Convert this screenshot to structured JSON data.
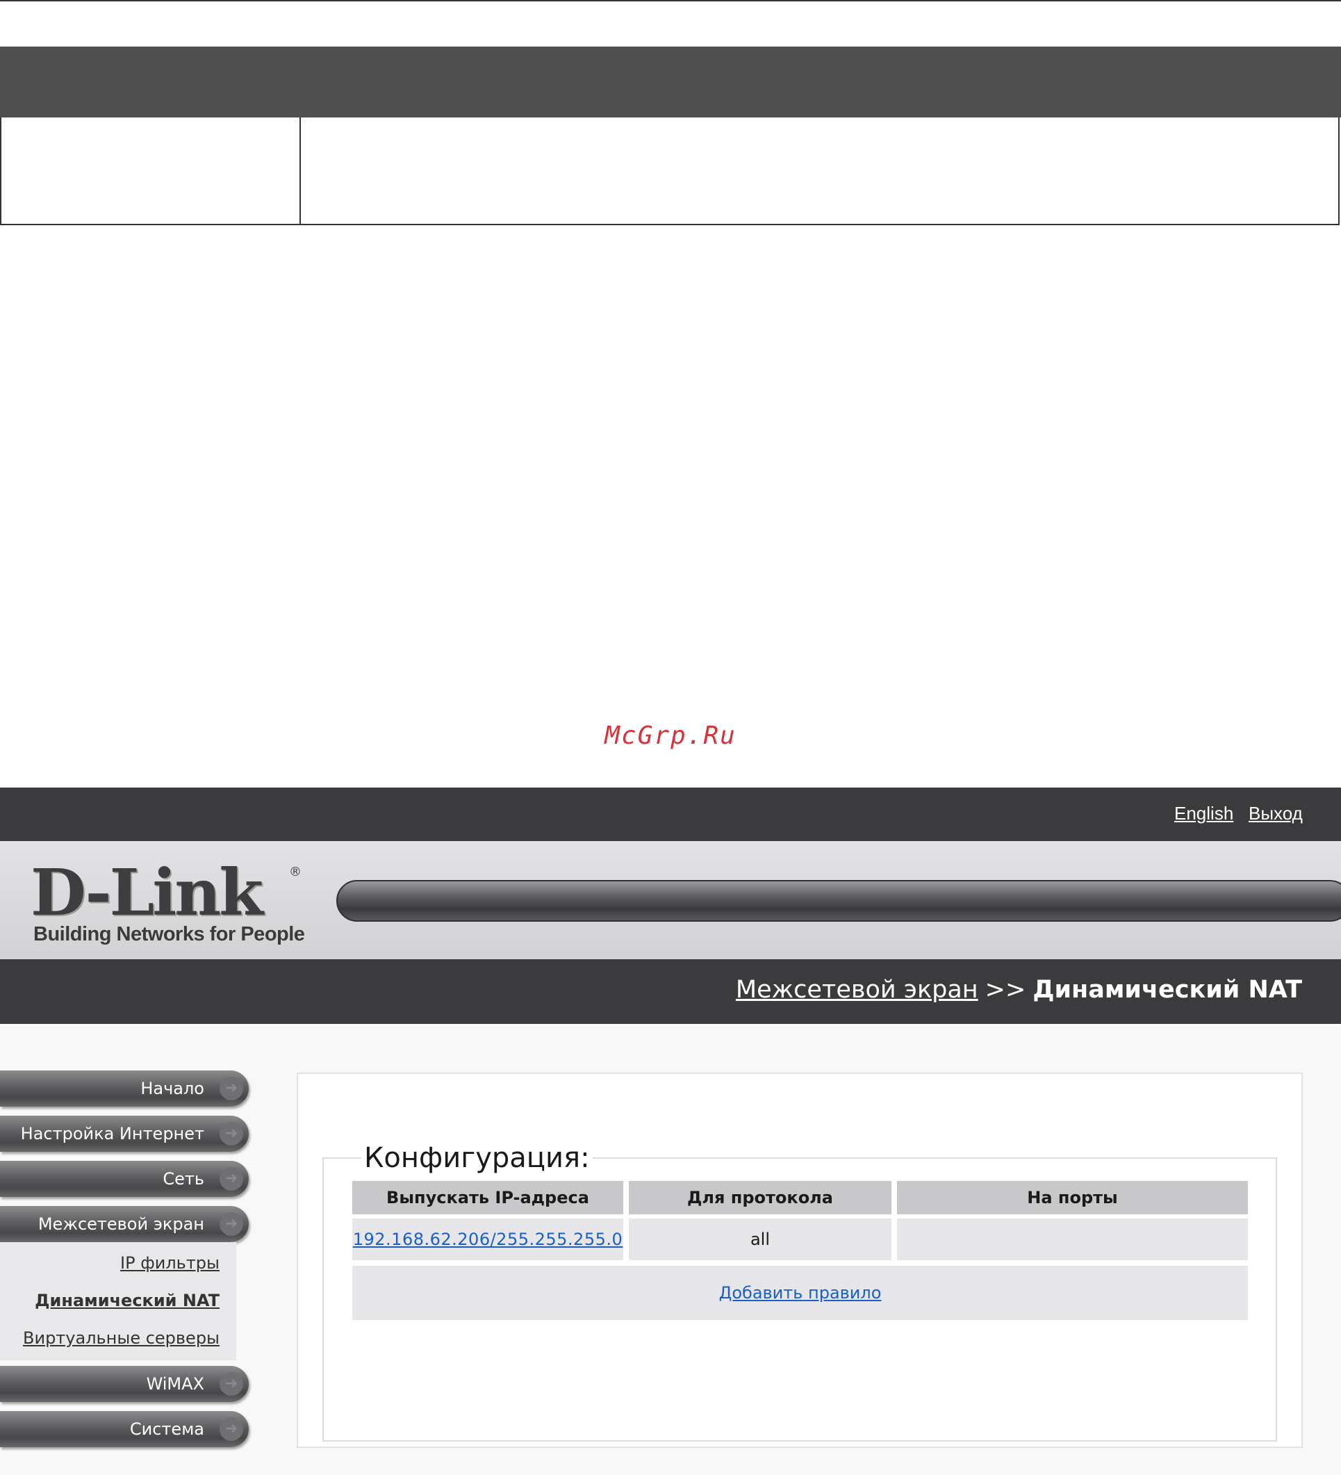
{
  "watermark": "McGrp.Ru",
  "header": {
    "links": {
      "english": "English",
      "logout": "Выход"
    }
  },
  "logo": {
    "brand": "D-Link",
    "registered": "®",
    "tagline": "Building Networks for People"
  },
  "breadcrumb": {
    "parent": "Межсетевой экран",
    "separator": ">>",
    "current": "Динамический NAT"
  },
  "sidebar": {
    "items": [
      {
        "label": "Начало"
      },
      {
        "label": "Настройка Интернет"
      },
      {
        "label": "Сеть"
      },
      {
        "label": "Межсетевой экран"
      },
      {
        "label": "WiMAX"
      },
      {
        "label": "Система"
      }
    ],
    "subitems": [
      {
        "label": "IP фильтры"
      },
      {
        "label": "Динамический NAT"
      },
      {
        "label": "Виртуальные серверы"
      }
    ]
  },
  "config": {
    "legend": "Конфигурация:",
    "columns": [
      "Выпускать IP-адреса",
      "Для протокола",
      "На порты"
    ],
    "rows": [
      {
        "ip": "192.168.62.206/255.255.255.0",
        "protocol": "all",
        "ports": ""
      }
    ],
    "add_rule": "Добавить правило"
  },
  "colors": {
    "dark_bar": "#3b3b3d",
    "link": "#1a5fc8",
    "watermark": "#d9323a"
  }
}
